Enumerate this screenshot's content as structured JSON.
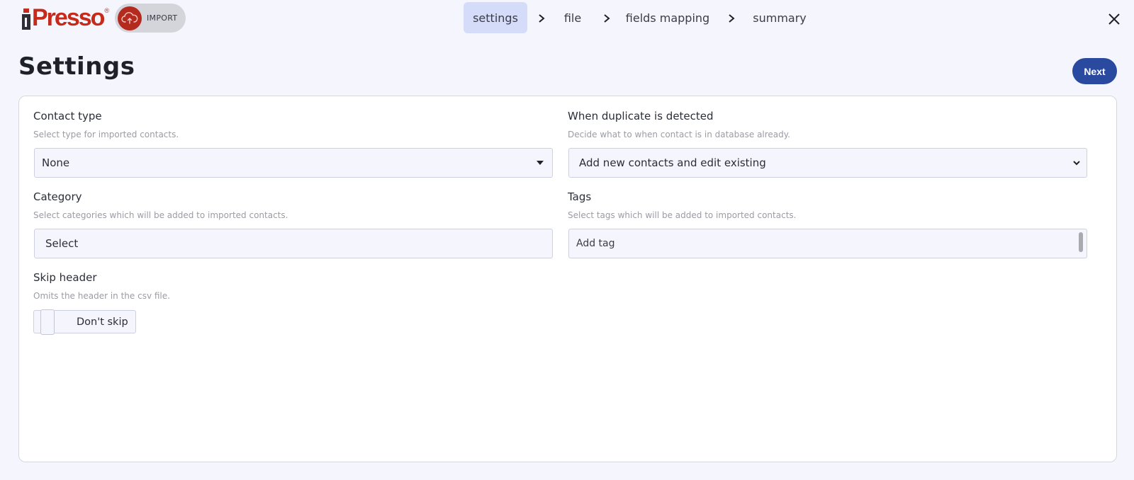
{
  "brand": {
    "logo_text": "Presso",
    "logo_mark": "i",
    "logo_registered": "®",
    "module_label": "IMPORT",
    "brand_red": "#c62a1a"
  },
  "steps": [
    {
      "label": "settings",
      "active": true
    },
    {
      "label": "file",
      "active": false
    },
    {
      "label": "fields mapping",
      "active": false
    },
    {
      "label": "summary",
      "active": false
    }
  ],
  "header": {
    "title": "Settings",
    "next_label": "Next"
  },
  "form": {
    "contact_type": {
      "label": "Contact type",
      "help": "Select type for imported contacts.",
      "value": "None"
    },
    "duplicate": {
      "label": "When duplicate is detected",
      "help": "Decide what to when contact is in database already.",
      "value": "Add new contacts and edit existing"
    },
    "category": {
      "label": "Category",
      "help": "Select categories which will be added to imported contacts.",
      "value": "Select"
    },
    "tags": {
      "label": "Tags",
      "help": "Select tags which will be added to imported contacts.",
      "placeholder": "Add tag"
    },
    "skip_header": {
      "label": "Skip header",
      "help": "Omits the header in the csv file.",
      "value": "Don't skip"
    }
  },
  "colors": {
    "accent": "#2a4a9f",
    "active_step_bg": "#d5dcfa",
    "page_bg": "#f5f6fd"
  },
  "icons": {
    "close": "close-icon",
    "step_separator": "chevron-right-icon",
    "import": "cloud-upload-icon"
  }
}
